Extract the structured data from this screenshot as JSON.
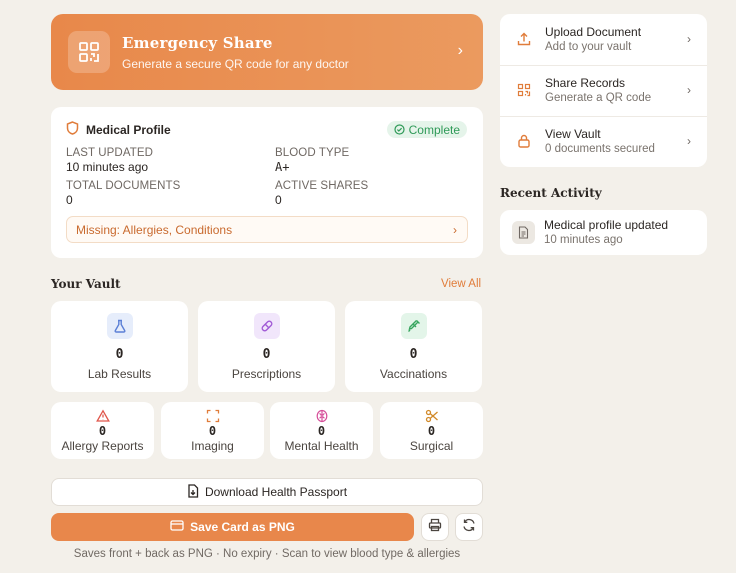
{
  "emergency": {
    "title": "Emergency Share",
    "subtitle": "Generate a secure QR code for any doctor"
  },
  "profile": {
    "title": "Medical Profile",
    "status": "Complete",
    "stats": [
      {
        "label": "LAST UPDATED",
        "value": "10 minutes ago"
      },
      {
        "label": "BLOOD TYPE",
        "value": "A+"
      },
      {
        "label": "TOTAL DOCUMENTS",
        "value": "0"
      },
      {
        "label": "ACTIVE SHARES",
        "value": "0"
      }
    ],
    "missing": "Missing: Allergies, Conditions"
  },
  "vault": {
    "title": "Your Vault",
    "view_all": "View All",
    "main": [
      {
        "label": "Lab Results",
        "count": "0",
        "icon": "flask-icon",
        "color": "#5b7fd6",
        "bg": "#e6edfb"
      },
      {
        "label": "Prescriptions",
        "count": "0",
        "icon": "pill-icon",
        "color": "#a15ad6",
        "bg": "#f1e6fb"
      },
      {
        "label": "Vaccinations",
        "count": "0",
        "icon": "syringe-icon",
        "color": "#37a55f",
        "bg": "#e3f5e9"
      }
    ],
    "secondary": [
      {
        "label": "Allergy Reports",
        "count": "0",
        "icon": "warning-icon",
        "color": "#e0564b"
      },
      {
        "label": "Imaging",
        "count": "0",
        "icon": "scan-icon",
        "color": "#e07c3a"
      },
      {
        "label": "Mental Health",
        "count": "0",
        "icon": "brain-icon",
        "color": "#d64f9a"
      },
      {
        "label": "Surgical",
        "count": "0",
        "icon": "scissors-icon",
        "color": "#d18a2a"
      }
    ]
  },
  "buttons": {
    "download": "Download Health Passport",
    "save": "Save Card as PNG",
    "note": "Saves front + back as PNG · No expiry · Scan to view blood type & allergies"
  },
  "actions": [
    {
      "title": "Upload Document",
      "subtitle": "Add to your vault",
      "icon": "upload-icon"
    },
    {
      "title": "Share Records",
      "subtitle": "Generate a QR code",
      "icon": "qr-icon"
    },
    {
      "title": "View Vault",
      "subtitle": "0 documents secured",
      "icon": "lock-icon"
    }
  ],
  "recent": {
    "title": "Recent Activity",
    "items": [
      {
        "title": "Medical profile updated",
        "time": "10 minutes ago",
        "icon": "document-icon"
      }
    ]
  },
  "colors": {
    "accent": "#e8874b",
    "background": "#f3f0ea",
    "success": "#2f9a58"
  }
}
